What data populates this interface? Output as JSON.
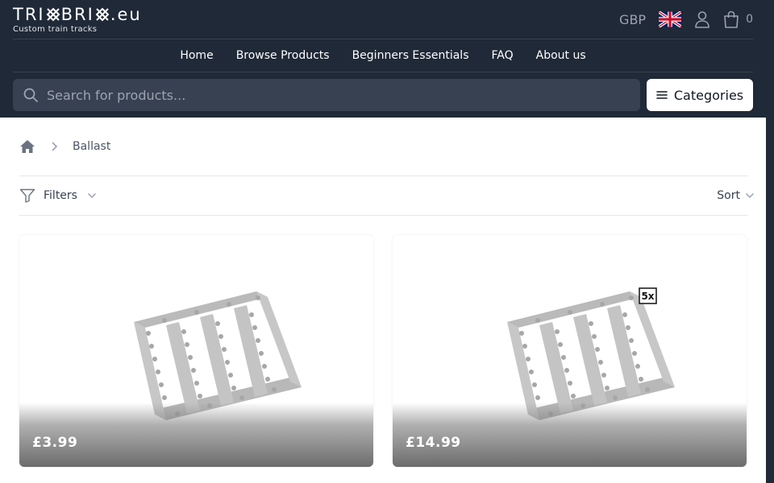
{
  "brand": {
    "logo_left": "TRI",
    "logo_mid": "BRI",
    "logo_right": ".eu",
    "tagline": "Custom train tracks"
  },
  "header": {
    "currency": "GBP",
    "cart_count": "0",
    "flag_icon": "uk-flag-icon"
  },
  "nav": {
    "items": [
      {
        "label": "Home"
      },
      {
        "label": "Browse Products"
      },
      {
        "label": "Beginners Essentials"
      },
      {
        "label": "FAQ"
      },
      {
        "label": "About us"
      }
    ]
  },
  "search": {
    "placeholder": "Search for products...",
    "value": ""
  },
  "categories": {
    "label": "Categories"
  },
  "breadcrumb": {
    "current": "Ballast"
  },
  "toolbar": {
    "filters_label": "Filters",
    "sort_label": "Sort"
  },
  "products": [
    {
      "price": "£3.99",
      "badge": ""
    },
    {
      "price": "£14.99",
      "badge": "5x"
    }
  ],
  "colors": {
    "header_bg": "#1f2937",
    "search_bg": "#374151",
    "piece_gray": "#c8c9c8"
  }
}
